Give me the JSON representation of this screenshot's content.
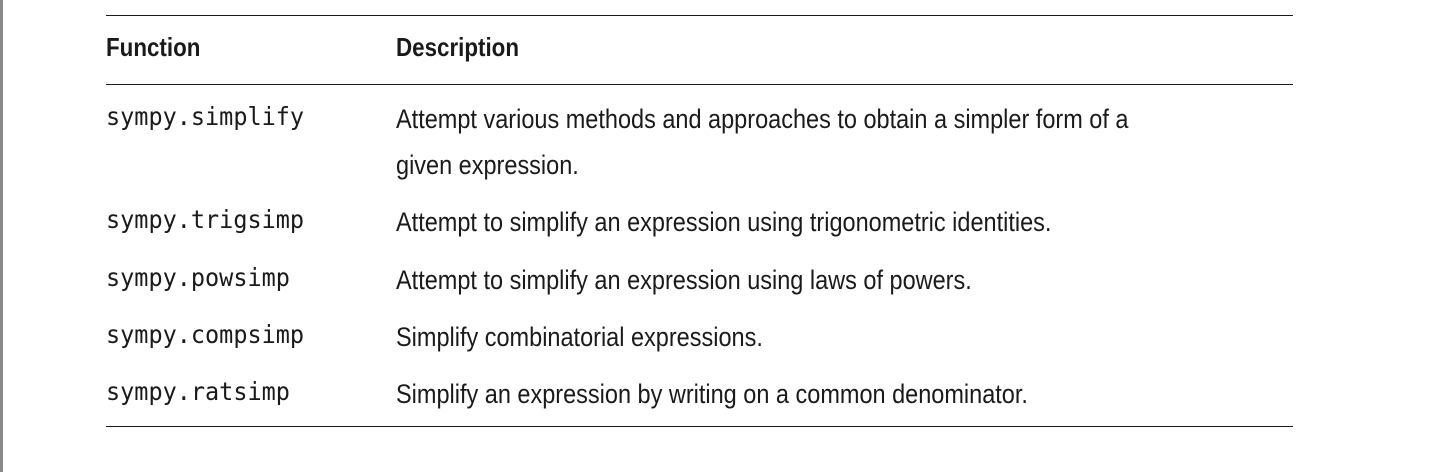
{
  "table": {
    "headers": {
      "function": "Function",
      "description": "Description"
    },
    "rows": [
      {
        "function": "sympy.simplify",
        "description_lines": [
          "Attempt various methods and approaches to obtain a simpler form of a",
          "given expression."
        ]
      },
      {
        "function": "sympy.trigsimp",
        "description_lines": [
          "Attempt to simplify an expression using trigonometric identities."
        ]
      },
      {
        "function": "sympy.powsimp",
        "description_lines": [
          "Attempt to simplify an expression using laws of powers."
        ]
      },
      {
        "function": "sympy.compsimp",
        "description_lines": [
          "Simplify combinatorial expressions."
        ]
      },
      {
        "function": "sympy.ratsimp",
        "description_lines": [
          "Simplify an expression by writing on a common denominator."
        ]
      }
    ]
  }
}
